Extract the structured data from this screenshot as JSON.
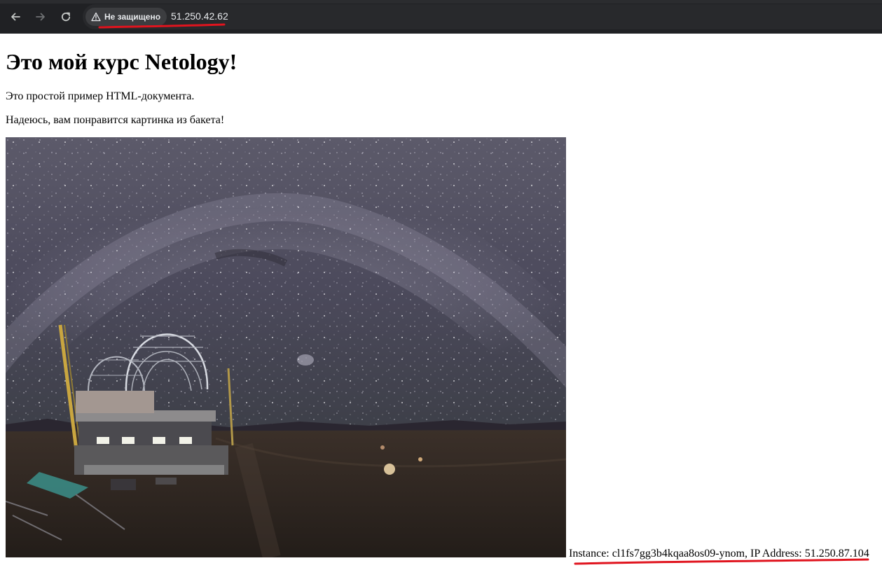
{
  "browser": {
    "security_label": "Не защищено",
    "url": "51.250.42.62",
    "icons": {
      "back": "arrow-left-icon",
      "forward": "arrow-right-icon",
      "reload": "reload-icon",
      "security": "warning-triangle-icon"
    },
    "annotation_color": "#e0141e"
  },
  "page": {
    "title": "Это мой курс Netology!",
    "paragraph1": "Это простой пример HTML-документа.",
    "paragraph2": "Надеюсь, вам понравится картинка из бакета!",
    "image": {
      "subject": "panoramic night sky with Milky Way over an observatory dome under construction"
    },
    "instance_info": "Instance: cl1fs7gg3b4kqaa8os09-ynom, IP Address: 51.250.87.104"
  }
}
